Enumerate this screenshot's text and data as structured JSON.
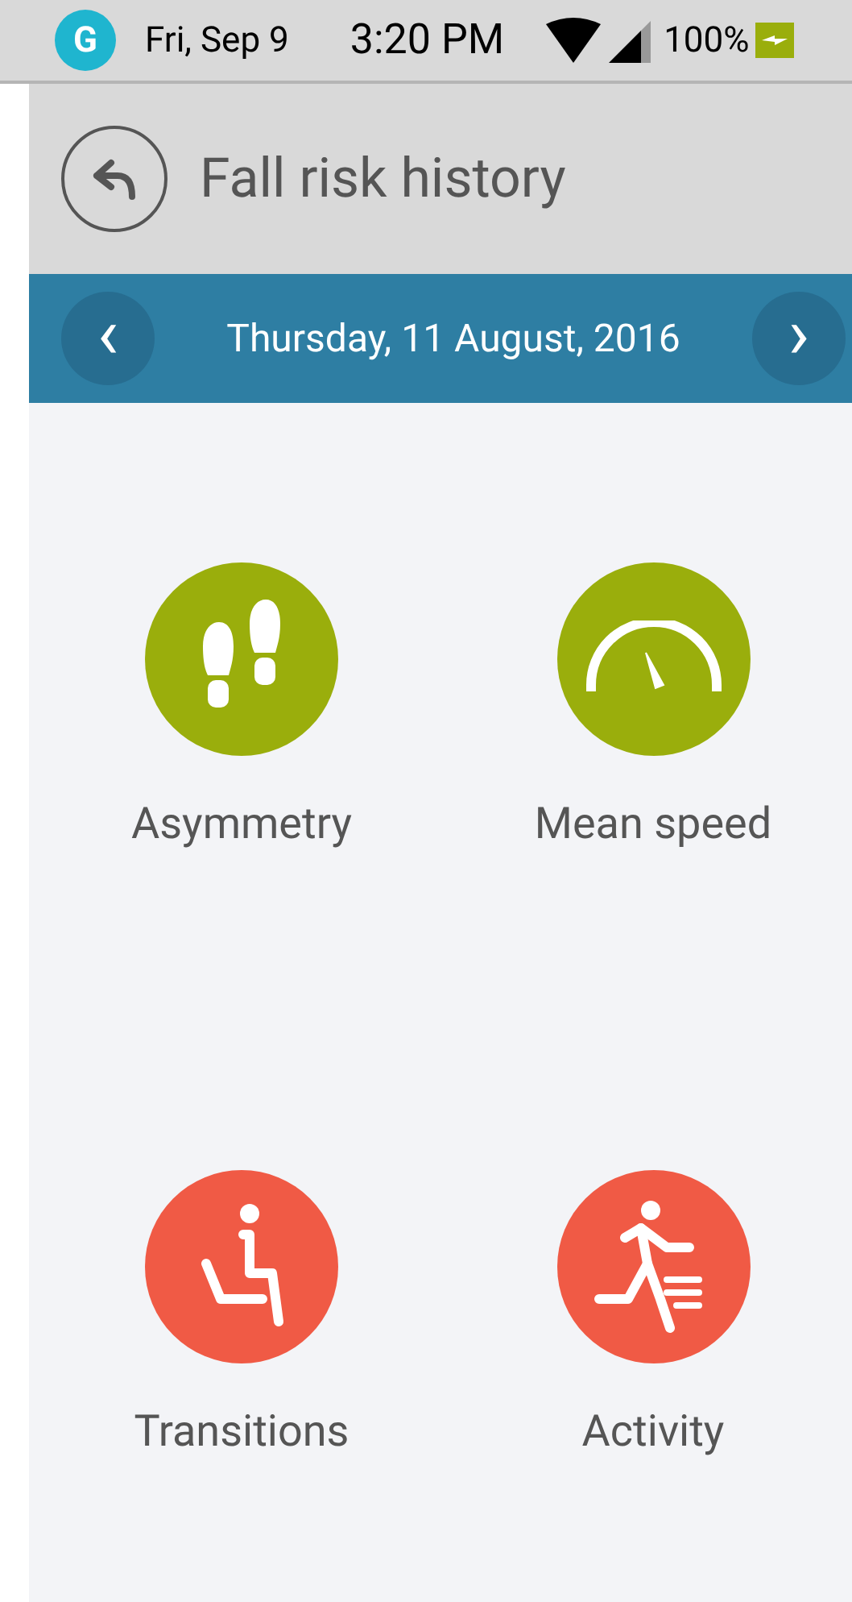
{
  "status_bar": {
    "app_logo": "G",
    "date": "Fri, Sep 9",
    "time": "3:20 PM",
    "battery": "100%"
  },
  "header": {
    "title": "Fall risk history"
  },
  "date_bar": {
    "prev": "‹",
    "date": "Thursday, 11 August, 2016",
    "next": "›"
  },
  "tiles": [
    {
      "label": "Asymmetry",
      "kind": "footprints",
      "color": "#9aae0c"
    },
    {
      "label": "Mean speed",
      "kind": "gauge",
      "color": "#9aae0c"
    },
    {
      "label": "Transitions",
      "kind": "sitting",
      "color": "#f05a45"
    },
    {
      "label": "Activity",
      "kind": "running",
      "color": "#f05a45"
    }
  ]
}
